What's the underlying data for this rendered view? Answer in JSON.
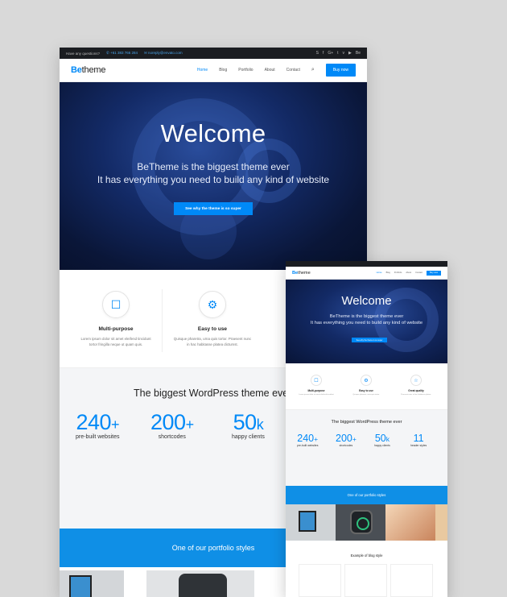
{
  "big": {
    "topbar": {
      "question": "Have any questions?",
      "phone": "+61 383 766 284",
      "email": "noreply@envato.com",
      "social_icons": [
        "skype-icon",
        "facebook-icon",
        "google-plus-icon",
        "twitter-icon",
        "vimeo-icon",
        "youtube-icon",
        "behance-icon"
      ],
      "social_glyphs": [
        "S",
        "f",
        "G+",
        "t",
        "v",
        "▶",
        "Be"
      ]
    },
    "logo": {
      "be": "Be",
      "theme": "theme"
    },
    "menu": [
      "Home",
      "Blog",
      "Portfolio",
      "About",
      "Contact"
    ],
    "search_glyph": "⌕",
    "buy": "Buy now",
    "hero": {
      "title": "Welcome",
      "line1": "BeTheme is the biggest theme ever",
      "line2": "It has everything you need to build any kind of website",
      "cta": "See why the theme is so super"
    },
    "features": [
      {
        "icon": "☐",
        "title": "Multi-purpose",
        "text1": "Lorem ipsum dolor sit amet eleifend tincidunt",
        "text2": "tortor fringilla neque ut quam quis."
      },
      {
        "icon": "⚙",
        "title": "Easy to use",
        "text1": "Quisque pharetra, urna quis tortor. Praesent nunc",
        "text2": "in hac habitasse platea dictumst."
      }
    ],
    "stats_title": "The biggest WordPress theme eve",
    "stats": [
      {
        "num": "240",
        "suffix": "+",
        "label": "pre-built websites"
      },
      {
        "num": "200",
        "suffix": "+",
        "label": "shortcodes"
      },
      {
        "num": "50",
        "suffix": "k",
        "label": "happy clients"
      }
    ],
    "portfolio": "One of our portfolio styles"
  },
  "small": {
    "logo": {
      "be": "Be",
      "theme": "theme"
    },
    "menu": [
      "Home",
      "Blog",
      "Portfolio",
      "About",
      "Contact"
    ],
    "buy": "Buy now",
    "hero": {
      "title": "Welcome",
      "line1": "BeTheme is the biggest theme ever",
      "line2": "It has everything you need to build any kind of website",
      "cta": "See why the theme is so super"
    },
    "features": [
      {
        "icon": "☐",
        "title": "Multi-purpose",
        "text": "Lorem ipsum dolor sit amet eleifend tincidunt"
      },
      {
        "icon": "⚙",
        "title": "Easy to use",
        "text": "Quisque pharetra, urna quis tortor."
      },
      {
        "icon": "☆",
        "title": "Great quality",
        "text": "Praesent nunc in hac habitasse platea."
      }
    ],
    "stats_title": "The biggest WordPress theme ever",
    "stats": [
      {
        "num": "240",
        "suffix": "+",
        "label": "pre-built websites"
      },
      {
        "num": "200",
        "suffix": "+",
        "label": "shortcodes"
      },
      {
        "num": "50",
        "suffix": "k",
        "label": "happy clients"
      },
      {
        "num": "11",
        "suffix": "",
        "label": "header styles"
      }
    ],
    "portfolio": "One of our portfolio styles",
    "blog": "Example of blog style"
  }
}
